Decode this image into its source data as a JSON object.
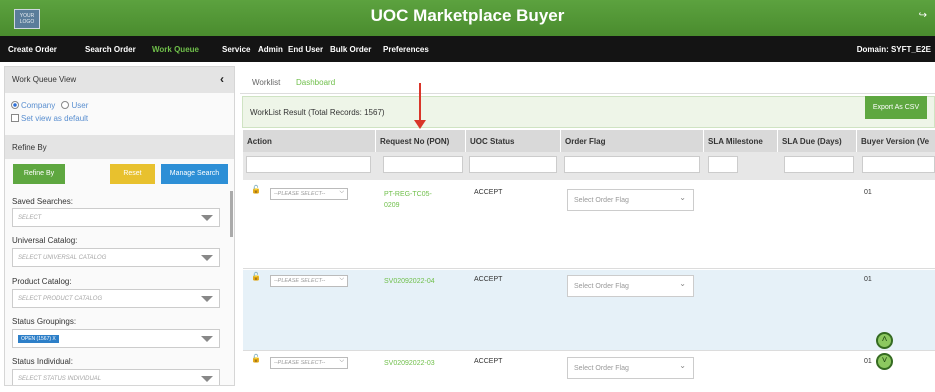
{
  "app": {
    "title": "UOC Marketplace Buyer",
    "logo_text": "YOUR LOGO",
    "exit_icon": "exit-icon"
  },
  "nav": {
    "items": [
      "Create Order",
      "Search Order",
      "Work Queue",
      "Service",
      "Admin",
      "End User",
      "Bulk Order",
      "Preferences"
    ],
    "active": "Work Queue",
    "domain": "Domain: SYFT_E2E"
  },
  "sidebar": {
    "title": "Work Queue View",
    "radio_company": "Company",
    "radio_user": "User",
    "selected_view": "Company",
    "set_default": "Set view as default",
    "refine_title": "Refine By",
    "buttons": {
      "refine": "Refine By",
      "reset": "Reset",
      "manage": "Manage Search"
    },
    "fields": [
      {
        "label": "Saved Searches:",
        "value": "SELECT"
      },
      {
        "label": "Universal Catalog:",
        "value": "SELECT UNIVERSAL CATALOG"
      },
      {
        "label": "Product Catalog:",
        "value": "SELECT PRODUCT CATALOG"
      },
      {
        "label": "Status Groupings:",
        "value": "OPEN (1567) X"
      },
      {
        "label": "Status Individual:",
        "value": "SELECT STATUS INDIVIDUAL"
      }
    ]
  },
  "tabs": {
    "worklist": "Worklist",
    "dashboard": "Dashboard"
  },
  "results": {
    "label": "WorkList Result (Total Records: 1567)",
    "export": "Export As CSV"
  },
  "table": {
    "columns": [
      "Action",
      "Request No (PON)",
      "UOC Status",
      "Order Flag",
      "SLA Milestone",
      "SLA Due (Days)",
      "Buyer Version (Ve"
    ],
    "action_placeholder": "--PLEASE SELECT--",
    "order_flag_placeholder": "Select Order Flag",
    "rows": [
      {
        "pon_line1": "PT-REG-TC05-",
        "pon_line2": "0209",
        "status": "ACCEPT",
        "buyer_version": "01"
      },
      {
        "pon_line1": "SV02092022-04",
        "pon_line2": "",
        "status": "ACCEPT",
        "buyer_version": "01"
      },
      {
        "pon_line1": "SV02092022-03",
        "pon_line2": "",
        "status": "ACCEPT",
        "buyer_version": "01"
      }
    ]
  },
  "colors": {
    "brand_green": "#5ca23f",
    "nav_bg": "#141414",
    "link_green": "#6fbf4a",
    "reset_yellow": "#e8c12e",
    "manage_blue": "#2d8fd6",
    "row_highlight": "#e6f1f8",
    "annotation_red": "#d9352a"
  }
}
